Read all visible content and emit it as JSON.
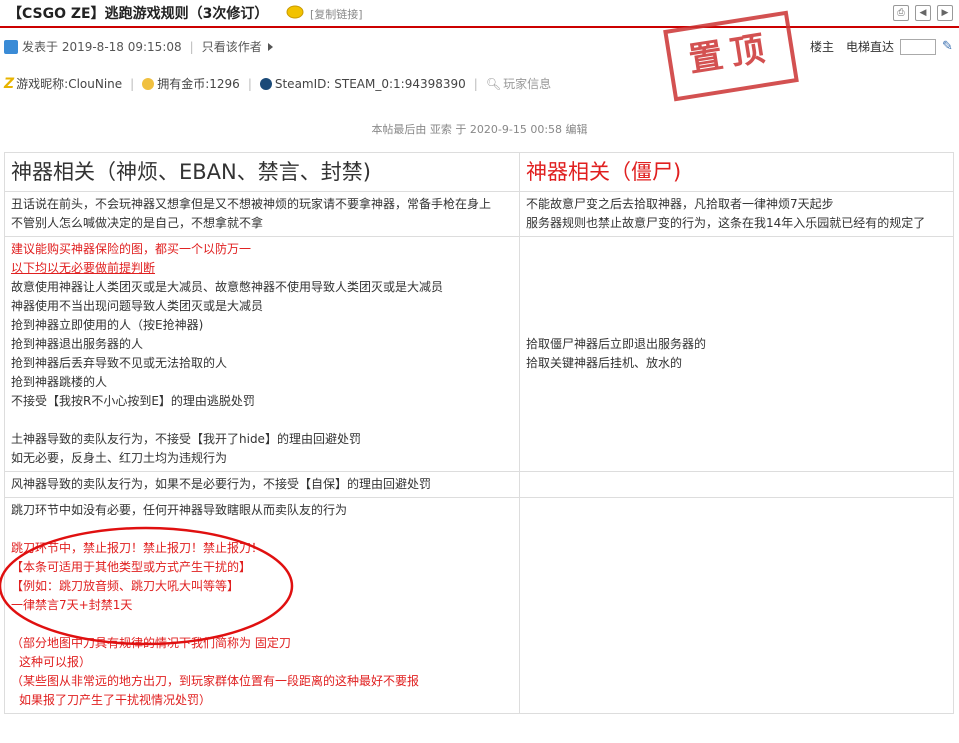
{
  "header": {
    "title": "【CSGO ZE】逃跑游戏规则（3次修订）",
    "copy_link": "[复制链接]",
    "tools": [
      "print-icon",
      "prev-icon",
      "next-icon"
    ]
  },
  "post": {
    "posted_at": "发表于 2019-8-18 09:15:08",
    "only_author": "只看该作者",
    "floor": "楼主",
    "elevator": "电梯直达",
    "stamp": "置顶"
  },
  "user": {
    "nickname": "游戏昵称:ClouNine",
    "gold": "拥有金币:1296",
    "steamid": "SteamID: STEAM_0:1:94398390",
    "player_info": "玩家信息",
    "sep": "|"
  },
  "edited": "本帖最后由 亚索 于 2020-9-15 00:58 编辑",
  "table": {
    "h1": "神器相关（神烦、EBAN、禁言、封禁)",
    "h2": "神器相关（僵尸)",
    "r1c1a": "丑话说在前头，不会玩神器又想拿但是又不想被神烦的玩家请不要拿神器，常备手枪在身上",
    "r1c1b": "不管别人怎么喊做决定的是自己，不想拿就不拿",
    "r1c2a": "不能故意尸变之后去拾取神器，凡拾取者一律神烦7天起步",
    "r1c2b": "服务器规则也禁止故意尸变的行为，这条在我14年入乐园就已经有的规定了",
    "r2": {
      "l1": "建议能购买神器保险的图，都买一个以防万一",
      "l2": "以下均以无必要做前提判断",
      "l3": "故意使用神器让人类团灭或是大减员、故意憋神器不使用导致人类团灭或是大减员",
      "l4": "神器使用不当出现问题导致人类团灭或是大减员",
      "l5": "抢到神器立即使用的人（按E抢神器)",
      "l6": "抢到神器退出服务器的人",
      "l7": "抢到神器后丢弃导致不见或无法拾取的人",
      "l8": "抢到神器跳楼的人",
      "l9": "不接受【我按R不小心按到E】的理由逃脱处罚",
      "l10": "土神器导致的卖队友行为，不接受【我开了hide】的理由回避处罚",
      "l11": "如无必要，反身土、红刀土均为违规行为"
    },
    "r2c2a": "拾取僵尸神器后立即退出服务器的",
    "r2c2b": "拾取关键神器后挂机、放水的",
    "r3": "风神器导致的卖队友行为，如果不是必要行为，不接受【自保】的理由回避处罚",
    "r4": {
      "l1": "跳刀环节中如没有必要，任何开神器导致瞎眼从而卖队友的行为",
      "l2": "跳刀环节中，禁止报刀！禁止报刀！禁止报刀！",
      "l3": "【本条可适用于其他类型或方式产生干扰的】",
      "l4": "【例如：跳刀放音频、跳刀大吼大叫等等】",
      "l5": "一律禁言7天+封禁1天",
      "l6": "（部分地图中刀具有规律的情况下我们简称为 固定刀",
      "l7": "这种可以报）",
      "l8": "（某些图从非常远的地方出刀，到玩家群体位置有一段距离的这种最好不要报",
      "l9": "如果报了刀产生了干扰视情况处罚）"
    }
  },
  "colors": {
    "accent": "#cc0000",
    "red_text": "#e02020",
    "stamp": "#cc3333"
  }
}
